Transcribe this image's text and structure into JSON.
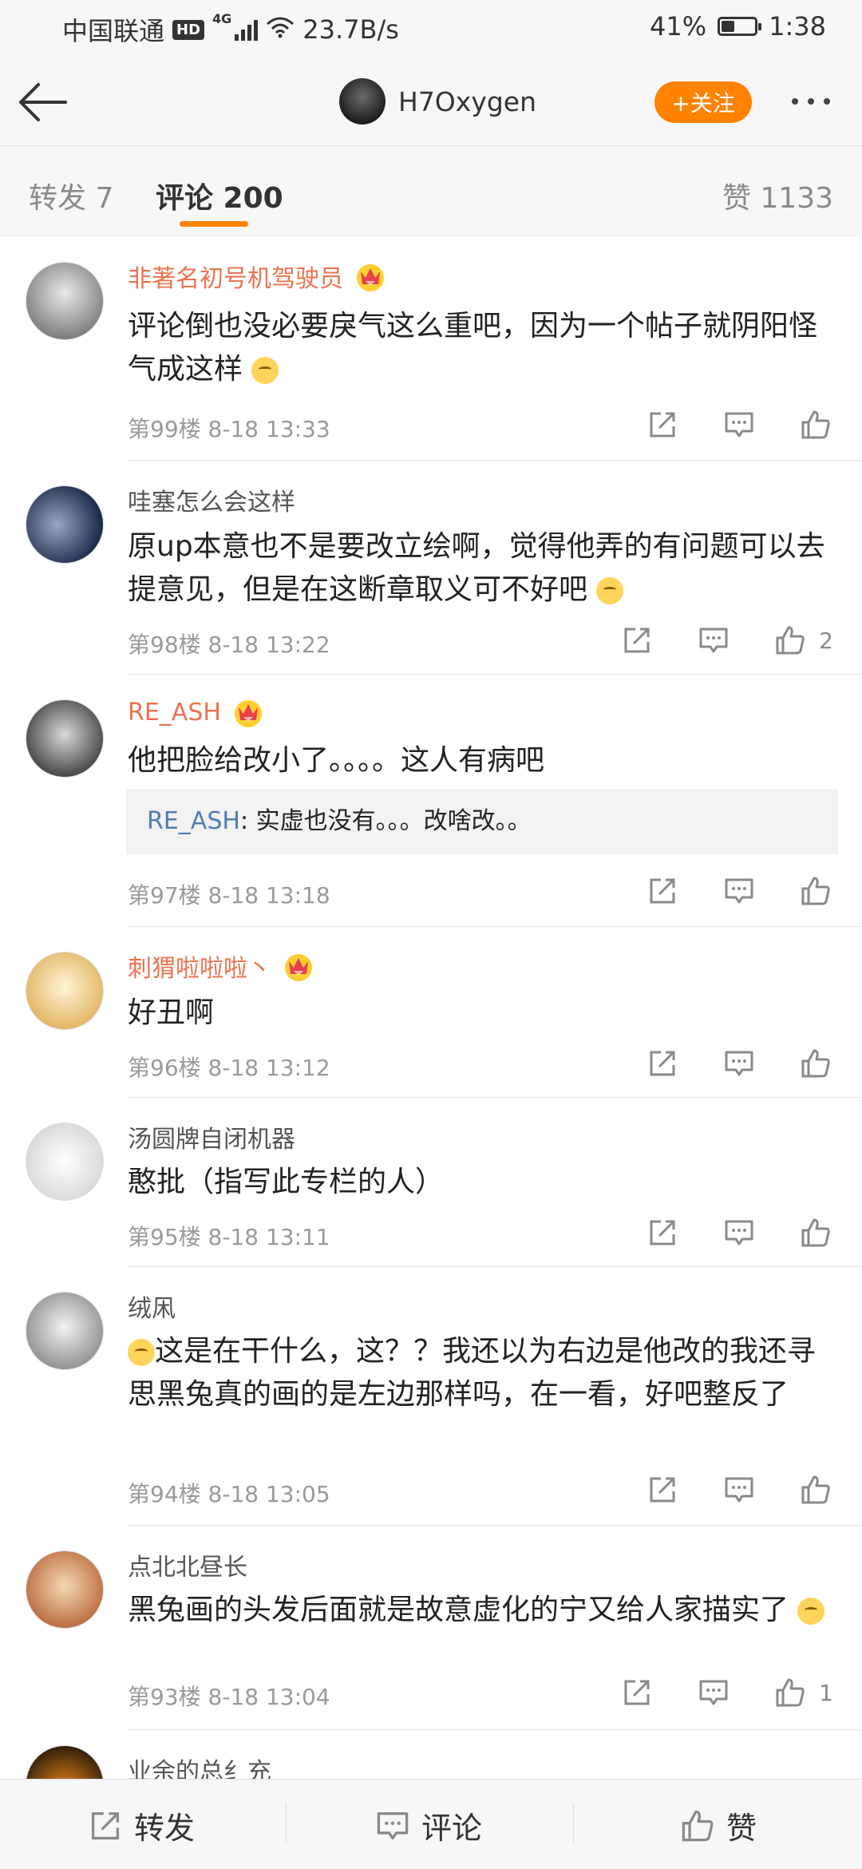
{
  "statusbar": {
    "carrier": "中国联通",
    "hd": "HD",
    "net_type": "4G",
    "speed": "23.7B/s",
    "battery_pct": "41%",
    "battery_level": 0.41,
    "time": "1:38"
  },
  "header": {
    "username": "H7Oxygen",
    "follow_label": "+关注"
  },
  "tabs": {
    "repost": "转发 7",
    "comment": "评论 200",
    "likes": "赞 1133"
  },
  "comments": [
    {
      "name": "非著名初号机驾驶员",
      "vip": true,
      "text": "评论倒也没必要戾气这么重吧，因为一个帖子就阴阳怪气成这样",
      "meta": "第99楼 8-18 13:33",
      "likes": ""
    },
    {
      "name": "哇塞怎么会这样",
      "vip": false,
      "text": "原up本意也不是要改立绘啊，觉得他弄的有问题可以去提意见，但是在这断章取义可不好吧",
      "meta": "第98楼 8-18 13:22",
      "likes": "2"
    },
    {
      "name": "RE_ASH",
      "vip": true,
      "text": "他把脸给改小了。。。。这人有病吧",
      "meta": "第97楼 8-18 13:18",
      "likes": "",
      "reply_name": "RE_ASH",
      "reply_text": ": 实虚也没有。。。改啥改。。"
    },
    {
      "name": "刺猬啦啦啦丶",
      "vip": true,
      "text": "好丑啊",
      "meta": "第96楼 8-18 13:12",
      "likes": ""
    },
    {
      "name": "汤圆牌自闭机器",
      "vip": false,
      "text": "憨批（指写此专栏的人）",
      "meta": "第95楼 8-18 13:11",
      "likes": ""
    },
    {
      "name": "绒凩",
      "vip": false,
      "text": "这是在干什么，这？？我还以为右边是他改的我还寻思黑兔真的画的是左边那样吗，在一看，好吧整反了",
      "meta": "第94楼 8-18 13:05",
      "likes": ""
    },
    {
      "name": "点北北昼长",
      "vip": false,
      "text": "黑兔画的头发后面就是故意虚化的宁又给人家描实了",
      "meta": "第93楼 8-18 13:04",
      "likes": "1"
    }
  ],
  "partial_comment_name": "业余的总纟充",
  "bottombar": {
    "repost": "转发",
    "comment": "评论",
    "like": "赞"
  },
  "colors": {
    "accent": "#ff8200",
    "vip_name": "#eb7350",
    "reply_name": "#507daf"
  }
}
